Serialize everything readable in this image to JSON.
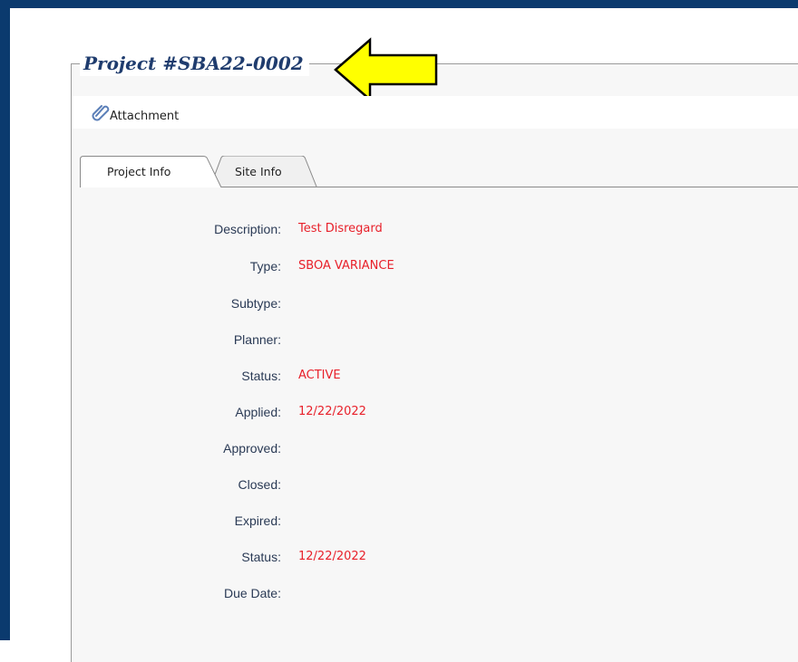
{
  "project": {
    "title": "Project #SBA22-0002"
  },
  "toolbar": {
    "attachment_label": "Attachment"
  },
  "tabs": [
    {
      "label": "Project Info",
      "active": true
    },
    {
      "label": "Site Info",
      "active": false
    }
  ],
  "fields": [
    {
      "label": "Description:",
      "value": "Test Disregard"
    },
    {
      "label": "Type:",
      "value": "SBOA VARIANCE"
    },
    {
      "label": "Subtype:",
      "value": ""
    },
    {
      "label": "Planner:",
      "value": ""
    },
    {
      "label": "Status:",
      "value": "ACTIVE"
    },
    {
      "label": "Applied:",
      "value": "12/22/2022"
    },
    {
      "label": "Approved:",
      "value": ""
    },
    {
      "label": "Closed:",
      "value": ""
    },
    {
      "label": "Expired:",
      "value": ""
    },
    {
      "label": "Status:",
      "value": "12/22/2022"
    },
    {
      "label": "Due Date:",
      "value": ""
    }
  ],
  "colors": {
    "frame": "#0b3a6e",
    "title": "#1f3c6e",
    "value": "#e8202a",
    "arrow_fill": "#ffff00"
  },
  "icons": {
    "attachment": "paperclip-icon",
    "annotation": "yellow-arrow-icon"
  }
}
